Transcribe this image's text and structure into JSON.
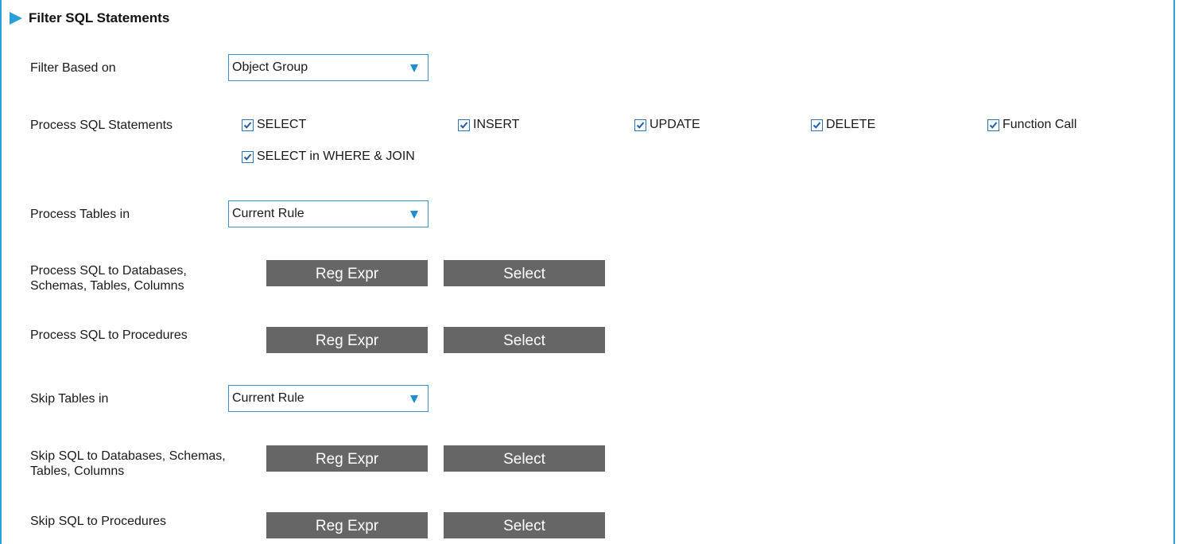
{
  "section": {
    "title": "Filter SQL Statements"
  },
  "filter_based_on": {
    "label": "Filter Based on",
    "value": "Object Group"
  },
  "process_sql_statements": {
    "label": "Process SQL Statements",
    "options": [
      {
        "label": "SELECT",
        "checked": true
      },
      {
        "label": "INSERT",
        "checked": true
      },
      {
        "label": "UPDATE",
        "checked": true
      },
      {
        "label": "DELETE",
        "checked": true
      },
      {
        "label": "Function Call",
        "checked": true
      },
      {
        "label": "SELECT in WHERE & JOIN",
        "checked": true
      }
    ]
  },
  "process_tables_in": {
    "label": "Process Tables in",
    "value": "Current Rule"
  },
  "process_sql_objects": {
    "label_line1": "Process SQL to Databases,",
    "label_line2": "Schemas, Tables, Columns",
    "regexp_label": "Reg Expr",
    "select_label": "Select"
  },
  "process_sql_procedures": {
    "label": "Process SQL to Procedures",
    "regexp_label": "Reg Expr",
    "select_label": "Select"
  },
  "skip_tables_in": {
    "label": "Skip Tables in",
    "value": "Current Rule"
  },
  "skip_sql_objects": {
    "label_line1": "Skip SQL to Databases, Schemas,",
    "label_line2": "Tables, Columns",
    "regexp_label": "Reg Expr",
    "select_label": "Select"
  },
  "skip_sql_procedures": {
    "label": "Skip SQL to Procedures",
    "regexp_label": "Reg Expr",
    "select_label": "Select"
  },
  "colors": {
    "accent": "#2a9fd8",
    "button_bg": "#666666",
    "button_text": "#ffffff"
  }
}
